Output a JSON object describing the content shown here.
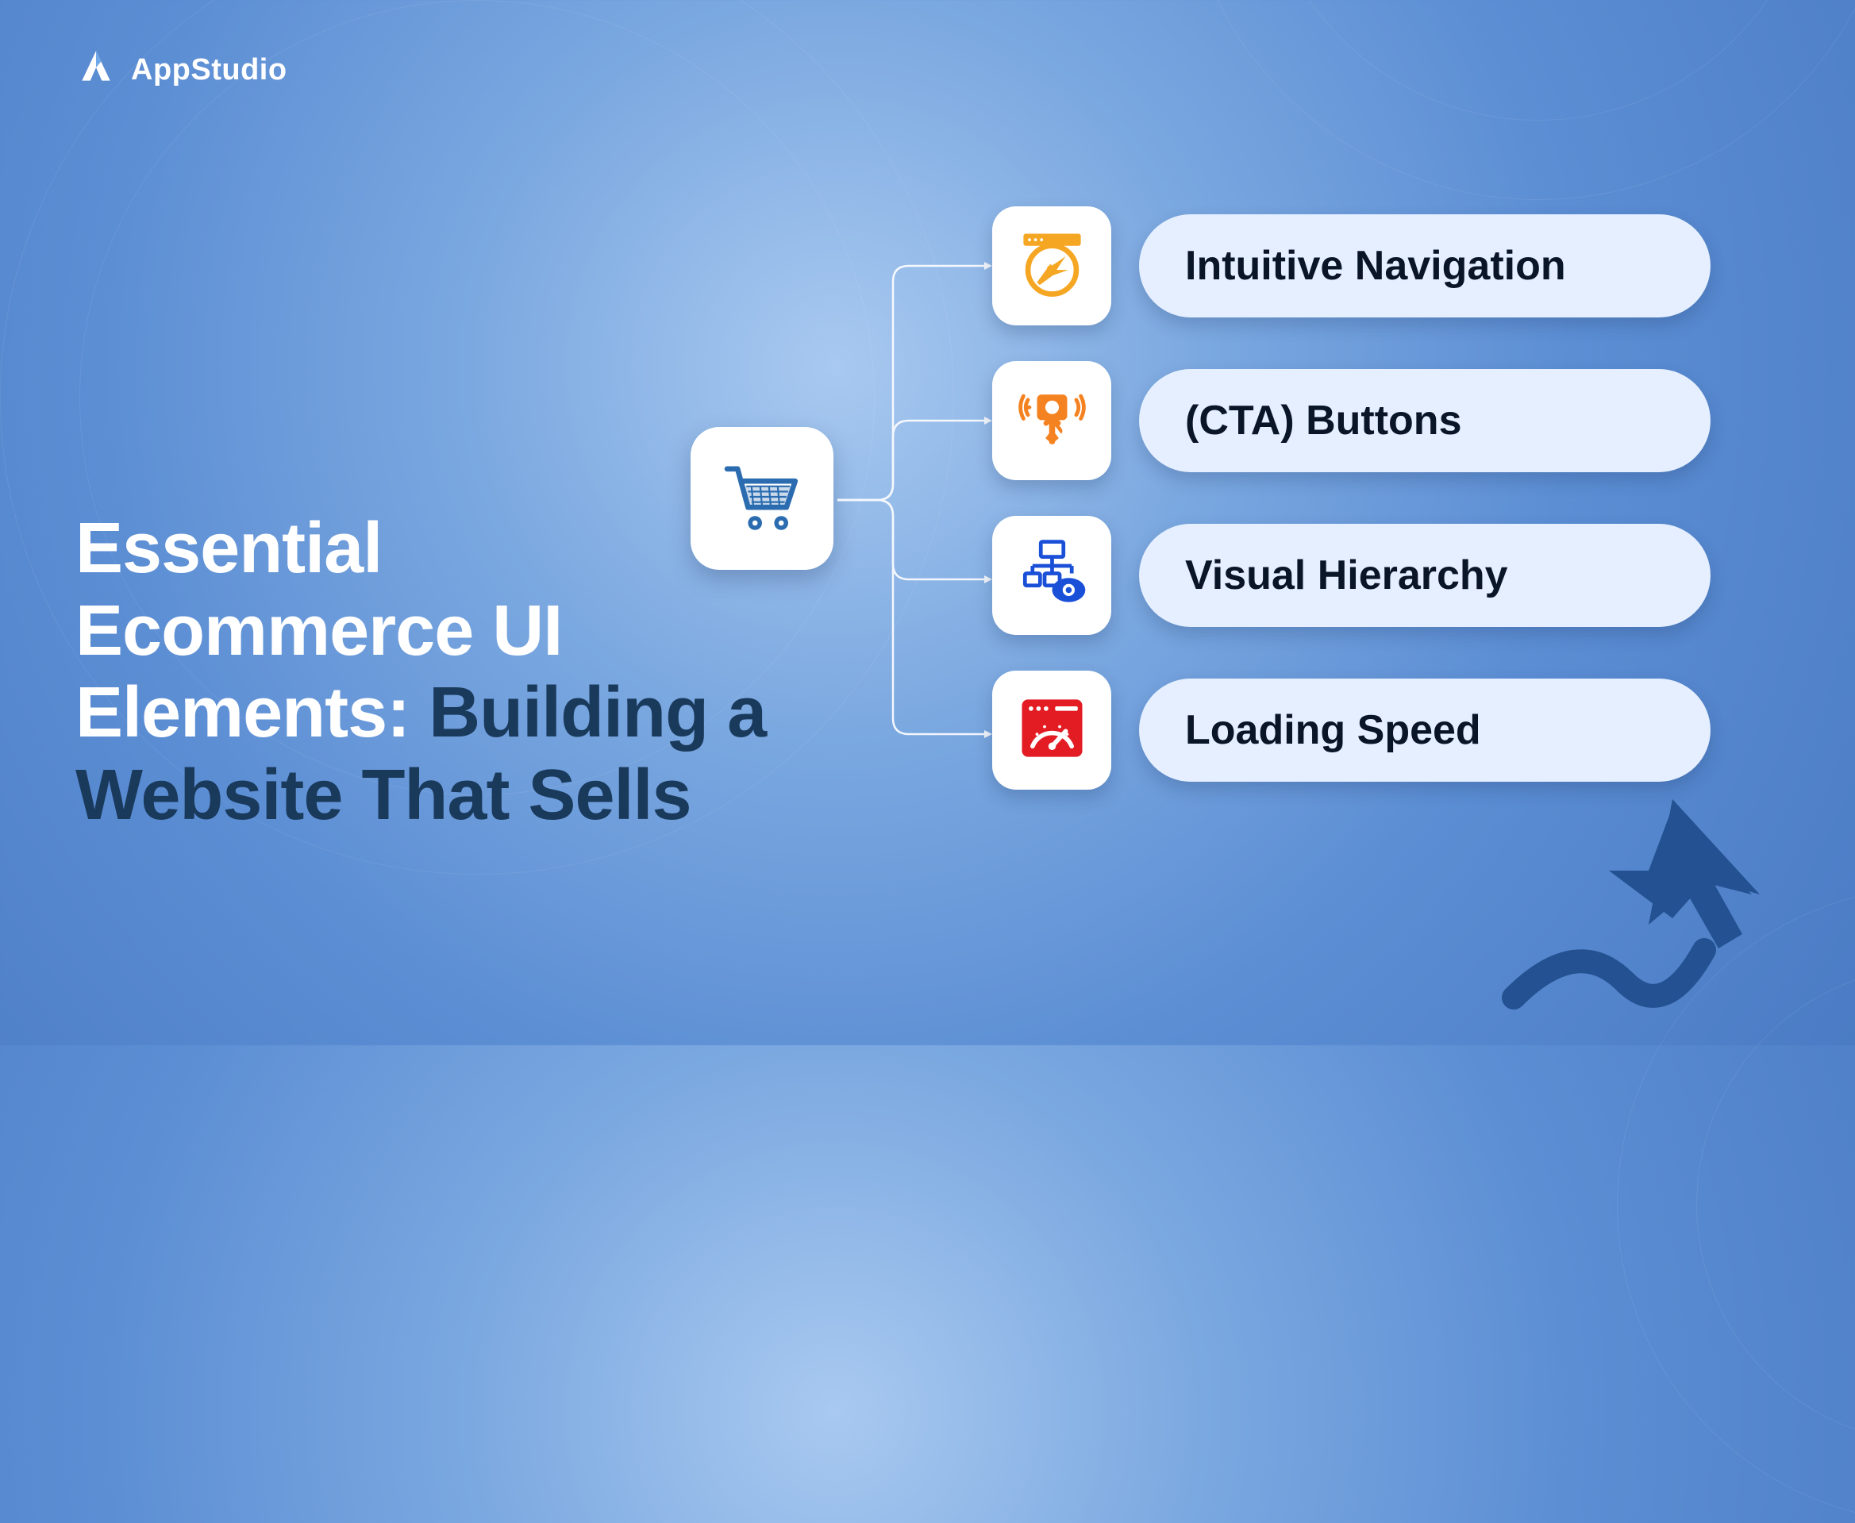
{
  "brand": {
    "name": "AppStudio"
  },
  "title": {
    "line1": "Essential",
    "line2": "Ecommerce UI",
    "line3_white": "Elements: ",
    "line3_dark": "Building a",
    "line4_dark": "Website That Sells"
  },
  "features": [
    {
      "label": "Intuitive Navigation",
      "icon": "navigation",
      "color": "#f5a623"
    },
    {
      "label": "(CTA) Buttons",
      "icon": "cta-button",
      "color": "#f58220"
    },
    {
      "label": "Visual Hierarchy",
      "icon": "hierarchy",
      "color": "#1a4fd8"
    },
    {
      "label": "Loading Speed",
      "icon": "speedometer",
      "color": "#e31b23"
    }
  ],
  "colors": {
    "bg_start": "#a8c9f0",
    "bg_end": "#4a7bc4",
    "title_white": "#ffffff",
    "title_dark": "#1a3a5c",
    "pill_bg": "#e5efff",
    "cart_blue": "#2b6cb0",
    "arrow": "#235191"
  }
}
